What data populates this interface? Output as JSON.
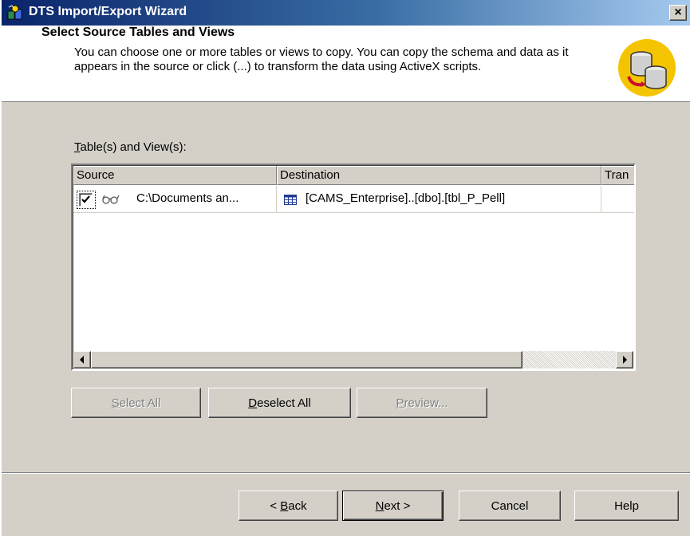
{
  "window": {
    "title": "DTS Import/Export Wizard",
    "close_label": "×"
  },
  "header": {
    "title": "Select Source Tables and Views",
    "description": "You can choose one or more tables or views to copy.  You can copy the schema and data as it appears in the source or click (...) to transform the data using ActiveX scripts.",
    "icon": "database-transform-icon"
  },
  "tables": {
    "label_accel": "T",
    "label_rest": "able(s) and View(s):",
    "columns": [
      "Source",
      "Destination",
      "Tran"
    ],
    "rows": [
      {
        "checked": true,
        "source_icon": "glasses-view-icon",
        "source": "C:\\Documents an...",
        "destination_icon": "table-grid-icon",
        "destination": "[CAMS_Enterprise]..[dbo].[tbl_P_Pell]",
        "transform": ""
      }
    ]
  },
  "selection_buttons": {
    "select_all": {
      "accel": "S",
      "rest": "elect All",
      "enabled": false
    },
    "deselect_all": {
      "accel": "D",
      "rest": "eselect All",
      "enabled": true
    },
    "preview": {
      "accel": "P",
      "rest": "review...",
      "enabled": false
    }
  },
  "nav_buttons": {
    "back": {
      "prefix": "< ",
      "accel": "B",
      "rest": "ack"
    },
    "next": {
      "accel": "N",
      "rest": "ext >"
    },
    "cancel": "Cancel",
    "help": "Help"
  },
  "colors": {
    "title_bar_start": "#0a246a",
    "title_bar_end": "#a6caf0",
    "dialog_face": "#d4d0c8",
    "header_icon_bg": "#f5c400"
  }
}
